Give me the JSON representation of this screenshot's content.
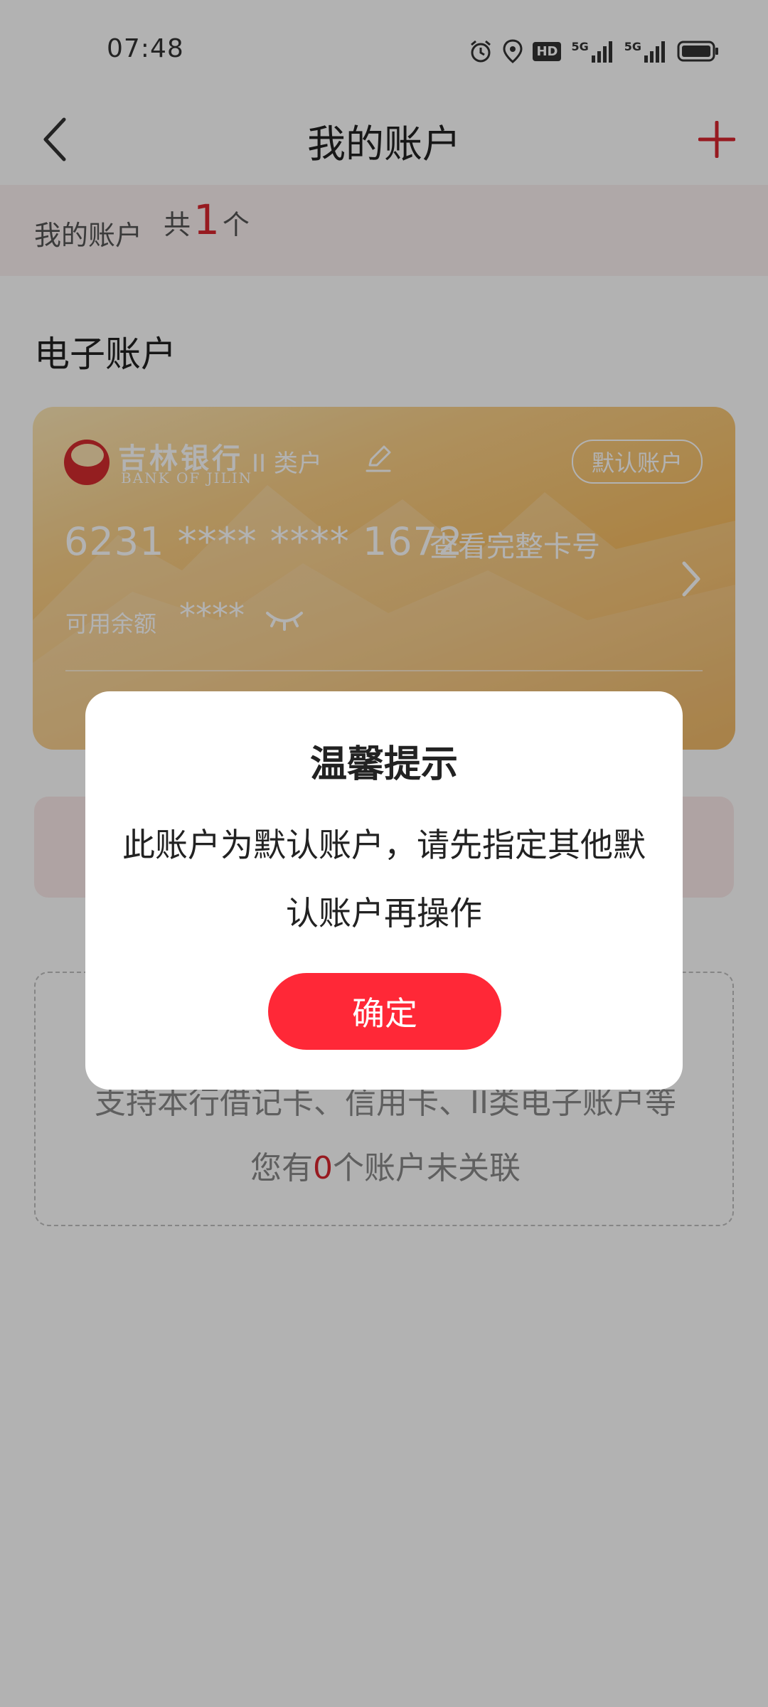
{
  "status_bar": {
    "time": "07:48",
    "icons": [
      "alarm-icon",
      "location-icon",
      "hd-icon",
      "5g-signal-icon",
      "5g-signal-icon",
      "battery-icon"
    ],
    "hd_label": "HD",
    "network_1": "5G",
    "network_2": "5G"
  },
  "nav": {
    "back_icon": "chevron-left-icon",
    "title": "我的账户",
    "add_icon": "plus-icon"
  },
  "summary": {
    "label": "我的账户",
    "prefix": "共",
    "count": "1",
    "suffix": "个"
  },
  "section": {
    "title": "电子账户"
  },
  "card": {
    "bank_name_cn": "吉林银行",
    "bank_name_en": "BANK OF JILIN",
    "account_type": "II 类户",
    "default_badge": "默认账户",
    "card_number": "6231 **** **** 1672",
    "view_full_label": "查看完整卡号",
    "balance_label": "可用余额",
    "balance_value": "****"
  },
  "linked_accounts": {
    "support_text": "支持本行借记卡、信用卡、II类电子账户等",
    "unlinked_prefix": "您有",
    "unlinked_count": "0",
    "unlinked_suffix": "个账户未关联"
  },
  "dialog": {
    "title": "温馨提示",
    "message": "此账户为默认账户，请先指定其他默认账户再操作",
    "confirm_label": "确定"
  },
  "colors": {
    "accent_red": "#d9262e",
    "button_red": "#ff2837",
    "card_gold": "#f6bd63",
    "overlay": "rgba(0,0,0,0.30)"
  }
}
